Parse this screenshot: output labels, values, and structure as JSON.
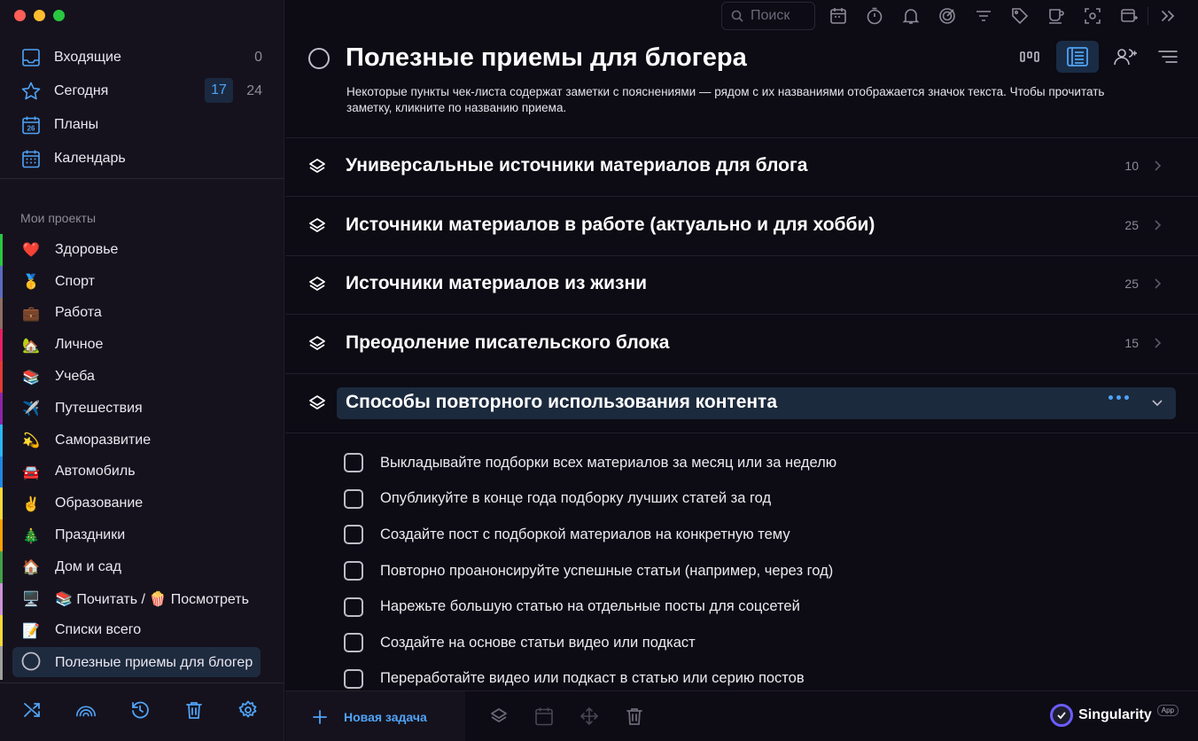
{
  "window": {
    "traffic_lights": [
      "#ff5f57",
      "#febc2e",
      "#28c840"
    ]
  },
  "sidebar": {
    "nav": [
      {
        "label": "Входящие",
        "count": "0",
        "icon": "inbox-icon"
      },
      {
        "label": "Сегодня",
        "badge": "17",
        "count": "24",
        "icon": "star-icon"
      },
      {
        "label": "Планы",
        "icon": "calendar-plan-icon",
        "icon_text": "26"
      },
      {
        "label": "Календарь",
        "icon": "calendar-grid-icon"
      }
    ],
    "projects_title": "Мои проекты",
    "projects": [
      {
        "emoji": "❤️",
        "label": "Здоровье",
        "color": "#28c840"
      },
      {
        "emoji": "🥇",
        "label": "Спорт",
        "color": "#5c6bc0"
      },
      {
        "emoji": "💼",
        "label": "Работа",
        "color": "#8d6e63"
      },
      {
        "emoji": "🏡",
        "label": "Личное",
        "color": "#e91e63"
      },
      {
        "emoji": "📚",
        "label": "Учеба",
        "color": "#e53935"
      },
      {
        "emoji": "✈️",
        "label": "Путешествия",
        "color": "#8e24aa"
      },
      {
        "emoji": "💫",
        "label": "Саморазвитие",
        "color": "#29b6f6"
      },
      {
        "emoji": "🚘",
        "label": "Автомобиль",
        "color": "#1e88e5"
      },
      {
        "emoji": "✌️",
        "label": "Образование",
        "color": "#fdd835"
      },
      {
        "emoji": "🎄",
        "label": "Праздники",
        "color": "#ffa000"
      },
      {
        "emoji": "🏠",
        "label": "Дом и сад",
        "color": "#43a047"
      },
      {
        "emoji": "🖥️",
        "label": "📚 Почитать / 🍿 Посмотреть",
        "color": "#ce93d8"
      },
      {
        "emoji": "📝",
        "label": "Списки всего",
        "color": "#fdd835"
      },
      {
        "emoji": "",
        "label": "Полезные приемы для блогера",
        "color": "#9e9e9e",
        "active": true
      }
    ],
    "tools": [
      "shuffle-icon",
      "rainbow-icon",
      "history-icon",
      "trash-icon",
      "settings-icon"
    ]
  },
  "toolbar": {
    "search_placeholder": "Поиск",
    "icons": [
      "calendar-icon",
      "timer-icon",
      "bell-icon",
      "focus-icon",
      "filter-icon",
      "tag-icon",
      "coffee-icon",
      "screenshot-icon",
      "add-window-icon"
    ],
    "collapse_icon": "double-chevron-right-icon"
  },
  "project": {
    "title": "Полезные приемы для блогера",
    "description": "Некоторые пункты чек-листа содержат заметки с пояснениями — рядом с их названиями отображается значок текста. Чтобы прочитать заметку, кликните по названию приема.",
    "views": [
      "kanban-view-icon",
      "list-view-icon",
      "add-people-icon",
      "sort-icon"
    ],
    "active_view": "list-view-icon"
  },
  "sections": [
    {
      "label": "Универсальные источники материалов для блога",
      "count": "10"
    },
    {
      "label": "Источники материалов в работе (актуально и для хобби)",
      "count": "25"
    },
    {
      "label": "Источники материалов из жизни",
      "count": "25"
    },
    {
      "label": "Преодоление писательского блока",
      "count": "15"
    },
    {
      "label": "Способы повторного использования контента",
      "count": "",
      "active": true
    }
  ],
  "tasks": [
    "Выкладывайте подборки всех материалов за месяц или за неделю",
    "Опубликуйте в конце года подборку лучших статей за год",
    "Создайте пост с подборкой материалов на конкретную тему",
    "Повторно проанонсируйте успешные статьи (например, через год)",
    "Нарежьте большую статью на отдельные посты для соцсетей",
    "Создайте на основе статьи видео или подкаст",
    "Переработайте видео или подкаст в статью или серию постов"
  ],
  "bottom": {
    "new_task_label": "Новая задача",
    "icons": [
      "layers-icon",
      "calendar-icon",
      "move-icon",
      "trash-icon"
    ],
    "brand_name": "Singularity",
    "brand_badge": "App"
  },
  "colors": {
    "accent": "#4fa3f7",
    "background": "#0d0b14",
    "sidebar": "#15121d",
    "highlight": "#1c2a3d"
  }
}
